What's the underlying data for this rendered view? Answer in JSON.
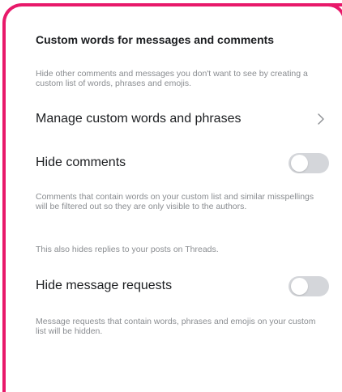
{
  "section": {
    "title": "Custom words for messages and comments",
    "description": "Hide other comments and messages you don't want to see by creating a custom list of words, phrases and emojis."
  },
  "manage_row": {
    "label": "Manage custom words and phrases",
    "icon": "chevron-right-icon"
  },
  "hide_comments": {
    "label": "Hide comments",
    "enabled": false,
    "description": "Comments that contain words on your custom list and similar misspellings will be filtered out so they are only visible to the authors.",
    "note": "This also hides replies to your posts on Threads."
  },
  "hide_message_requests": {
    "label": "Hide message requests",
    "enabled": false,
    "description": "Message requests that contain words, phrases and emojis on your custom list will be hidden."
  },
  "colors": {
    "frame": "#e8196a",
    "toggle_off": "#d4d6da",
    "text_primary": "#1c1e21",
    "text_secondary": "#8a8d91"
  }
}
